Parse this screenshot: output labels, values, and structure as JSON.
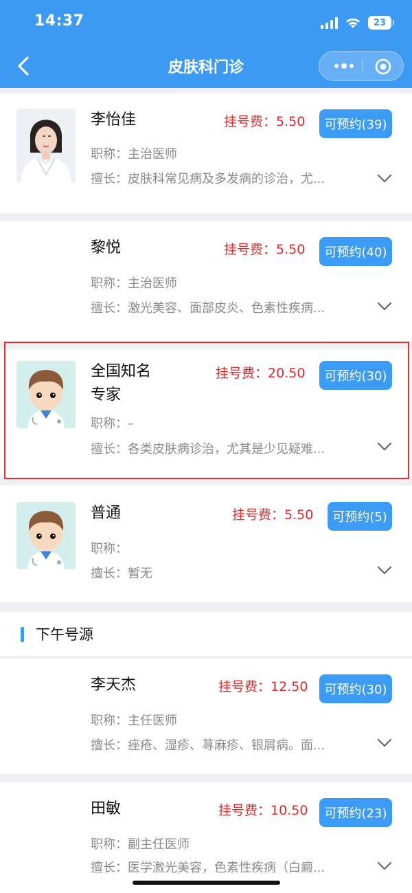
{
  "status_bar": {
    "time": "14:37",
    "battery": "23"
  },
  "nav": {
    "title": "皮肤科门诊"
  },
  "labels": {
    "fee_prefix": "挂号费：",
    "title_prefix": "职称：",
    "specialty_prefix": "擅长："
  },
  "doctors": [
    {
      "name": "李怡佳",
      "fee": "5.50",
      "book": "可预约(39)",
      "title": "主治医师",
      "specialty": "皮肤科常见病及多发病的诊治，尤..."
    },
    {
      "name": "黎悦",
      "fee": "5.50",
      "book": "可预约(40)",
      "title": "主治医师",
      "specialty": "激光美容、面部皮炎、色素性疾病..."
    },
    {
      "name_line1": "全国知名",
      "name_line2": "专家",
      "fee": "20.50",
      "book": "可预约(30)",
      "title": "–",
      "specialty": "各类皮肤病诊治，尤其是少见疑难..."
    },
    {
      "name": "普通",
      "fee": "5.50",
      "book": "可预约(5)",
      "title": "",
      "specialty": "暂无"
    }
  ],
  "afternoon": {
    "section_title": "下午号源",
    "doctors": [
      {
        "name": "李天杰",
        "fee": "12.50",
        "book": "可预约(30)",
        "title": "主任医师",
        "specialty": "痤疮、湿疹、荨麻疹、银屑病。面..."
      },
      {
        "name": "田敏",
        "fee": "10.50",
        "book": "可预约(23)",
        "title": "副主任医师",
        "specialty": "医学激光美容，色素性疾病（白癜..."
      }
    ]
  }
}
